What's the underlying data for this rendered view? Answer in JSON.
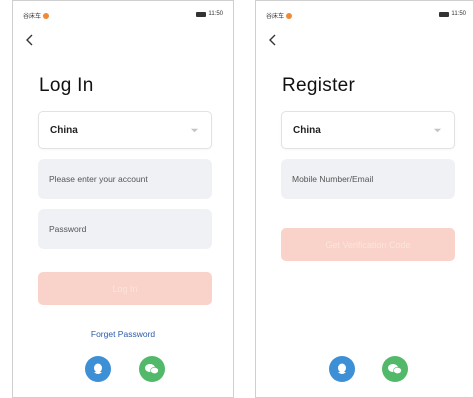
{
  "colors": {
    "accent_link": "#2b5ba8",
    "button_disabled": "#f9d3ca",
    "input_bg": "#f0f1f5",
    "qq_blue": "#3d8fd6",
    "wechat_green": "#53b96a"
  },
  "login": {
    "status_left": "谷床车",
    "status_right": "11:50",
    "title": "Log In",
    "country": "China",
    "account_placeholder": "Please enter your account",
    "password_placeholder": "Password",
    "login_button": "Log In",
    "forgot_link": "Forget Password",
    "social": [
      "qq-icon",
      "wechat-icon"
    ]
  },
  "register": {
    "status_left": "谷床车",
    "status_right": "11:50",
    "title": "Register",
    "country": "China",
    "mobile_placeholder": "Mobile Number/Email",
    "code_button": "Get Verification Code",
    "social": [
      "qq-icon",
      "wechat-icon"
    ]
  }
}
